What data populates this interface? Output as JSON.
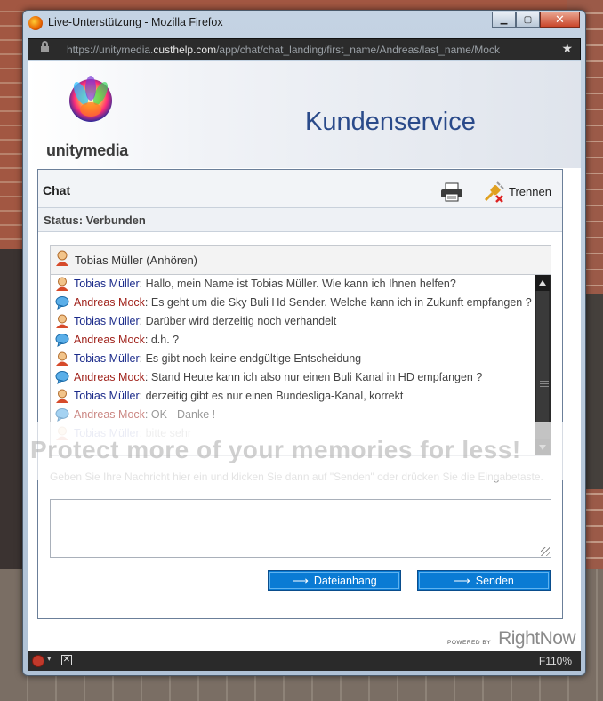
{
  "window": {
    "title": "Live-Unterstützung - Mozilla Firefox",
    "url_prefix": "https://unitymedia.",
    "url_domain": "custhelp.com",
    "url_path": "/app/chat/chat_landing/first_name/Andreas/last_name/Mock"
  },
  "banner": {
    "brand": "unitymedia",
    "heading": "Kundenservice"
  },
  "chat": {
    "title": "Chat",
    "disconnect_label": "Trennen",
    "status": "Status: Verbunden",
    "agent_label": "Tobias Müller (Anhören)",
    "messages": [
      {
        "sender": "Tobias Müller",
        "role": "agent",
        "text": ": Hallo, mein Name ist Tobias Müller. Wie kann ich Ihnen helfen?"
      },
      {
        "sender": "Andreas Mock",
        "role": "customer",
        "text": ": Es geht um die Sky Buli Hd Sender. Welche kann ich in Zukunft empfangen ?"
      },
      {
        "sender": "Tobias Müller",
        "role": "agent",
        "text": ": Darüber wird derzeitig noch verhandelt"
      },
      {
        "sender": "Andreas Mock",
        "role": "customer",
        "text": ": d.h. ?"
      },
      {
        "sender": "Tobias Müller",
        "role": "agent",
        "text": ": Es gibt noch keine endgültige Entscheidung"
      },
      {
        "sender": "Andreas Mock",
        "role": "customer",
        "text": ": Stand Heute kann ich also nur einen Buli Kanal in HD empfangen ?"
      },
      {
        "sender": "Tobias Müller",
        "role": "agent",
        "text": ": derzeitig gibt es nur einen Bundesliga-Kanal, korrekt"
      },
      {
        "sender": "Andreas Mock",
        "role": "customer",
        "text": ": OK - Danke !"
      },
      {
        "sender": "Tobias Müller",
        "role": "agent",
        "text": ": bitte sehr"
      }
    ],
    "input_hint": "Geben Sie Ihre Nachricht hier ein und klicken Sie dann auf \"Senden\" oder drücken Sie die Eingabetaste.",
    "input_value": "",
    "attach_label": "Dateianhang",
    "send_label": "Senden"
  },
  "watermark": "Protect more of your memories for less!",
  "footer": {
    "powered_by": "POWERED BY",
    "vendor": "RightNow"
  },
  "statusbar": {
    "zoom": "F110%"
  },
  "colors": {
    "accent": "#0a7bd4",
    "agent_name": "#1a2a8a",
    "customer_name": "#a0231c",
    "heading": "#2a4a8a"
  }
}
